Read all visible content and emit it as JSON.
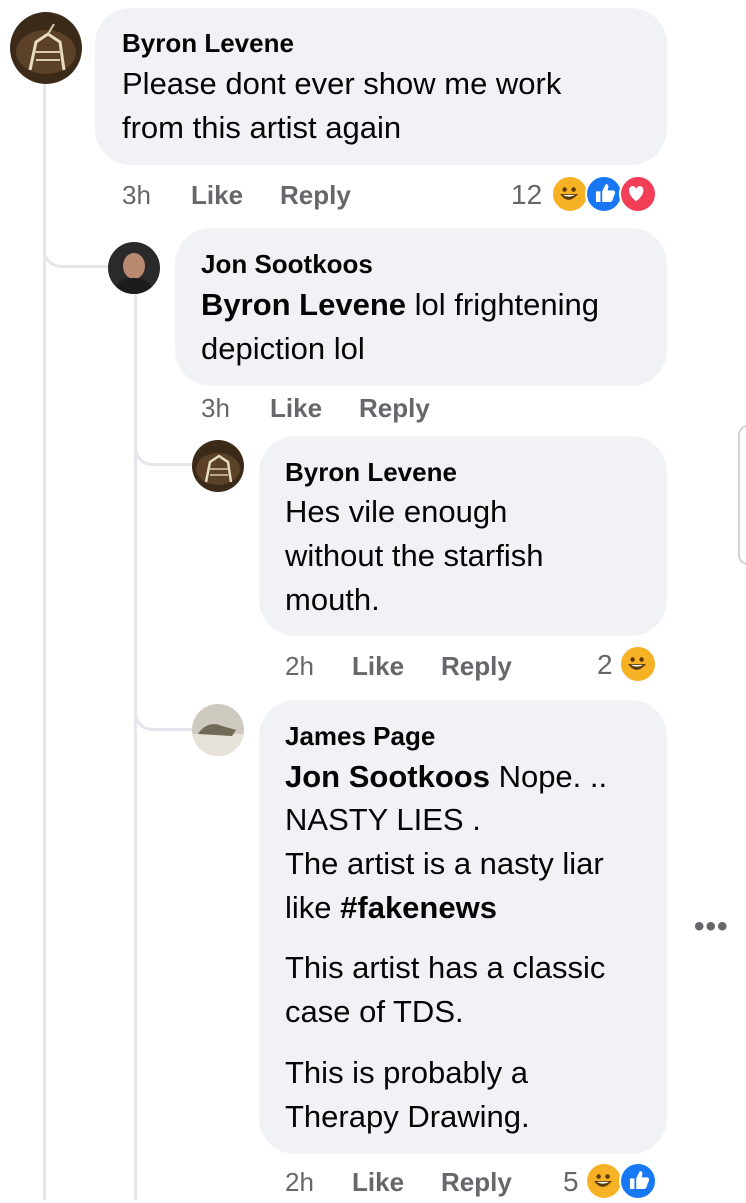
{
  "comments": [
    {
      "author": "Byron Levene",
      "lines": [
        "Please dont ever show me work",
        "from this artist again"
      ],
      "time": "3h",
      "like_label": "Like",
      "reply_label": "Reply",
      "reaction_count": "12",
      "reactions": [
        "haha",
        "like",
        "love"
      ]
    },
    {
      "author": "Jon Sootkoos",
      "mention": "Byron Levene",
      "lines": [
        " lol frightening",
        "depiction lol"
      ],
      "time": "3h",
      "like_label": "Like",
      "reply_label": "Reply"
    },
    {
      "author": "Byron Levene",
      "lines": [
        "Hes vile enough",
        "without the starfish",
        "mouth."
      ],
      "time": "2h",
      "like_label": "Like",
      "reply_label": "Reply",
      "reaction_count": "2",
      "reactions": [
        "haha"
      ]
    },
    {
      "author": "James Page",
      "mention": "Jon Sootkoos",
      "lines": [
        " Nope. ..",
        "NASTY LIES .",
        "The artist is a nasty liar",
        "like ",
        "This artist has a classic",
        "case of TDS.",
        "This is probably a",
        "Therapy Drawing."
      ],
      "hashtag": "#fakenews",
      "time": "2h",
      "like_label": "Like",
      "reply_label": "Reply",
      "reaction_count": "5",
      "reactions": [
        "haha",
        "like"
      ]
    }
  ],
  "more_menu": "•••",
  "colors": {
    "bubble": "#f0f2f5",
    "meta_text": "#65676b",
    "like_blue": "#1877f2",
    "love_red": "#f33e58",
    "haha_yellow": "#f7b125"
  }
}
